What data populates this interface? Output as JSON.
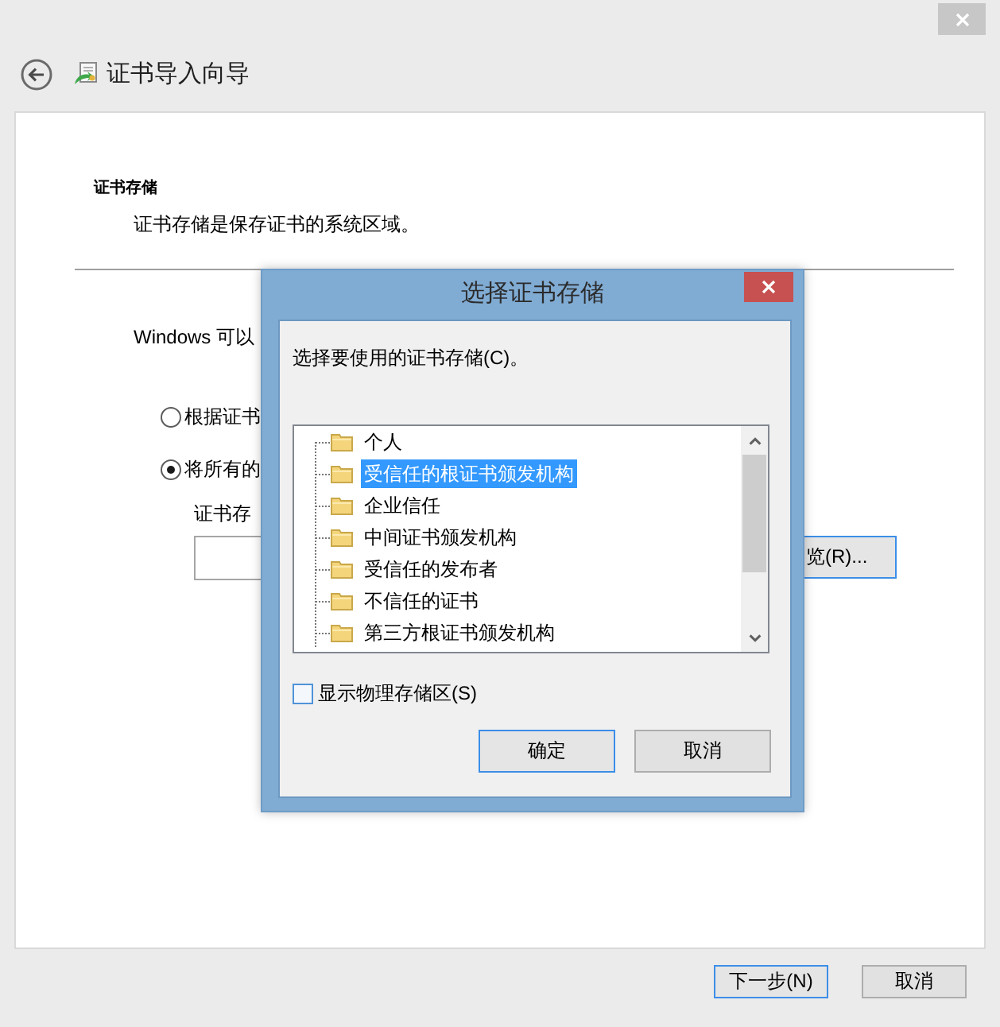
{
  "window": {
    "title": "证书导入向导"
  },
  "section": {
    "heading": "证书存储",
    "description": "证书存储是保存证书的系统区域。"
  },
  "intro": "Windows 可以",
  "options": [
    {
      "label": "根据证书",
      "selected": false
    },
    {
      "label": "将所有的",
      "selected": true
    }
  ],
  "store_field": {
    "label": "证书存"
  },
  "browse_button": {
    "label": "览(R)...",
    "focused": true
  },
  "dialog": {
    "title": "选择证书存储",
    "prompt": "选择要使用的证书存储(C)。",
    "stores": [
      {
        "name": "个人",
        "selected": false
      },
      {
        "name": "受信任的根证书颁发机构",
        "selected": true
      },
      {
        "name": "企业信任",
        "selected": false
      },
      {
        "name": "中间证书颁发机构",
        "selected": false
      },
      {
        "name": "受信任的发布者",
        "selected": false
      },
      {
        "name": "不信任的证书",
        "selected": false
      },
      {
        "name": "第三方根证书颁发机构",
        "selected": false
      }
    ],
    "show_physical": {
      "label": "显示物理存储区(S)",
      "checked": false
    },
    "buttons": [
      {
        "label": "确定",
        "focused": true
      },
      {
        "label": "取消",
        "focused": false
      }
    ]
  },
  "footer_buttons": [
    {
      "label": "下一步(N)",
      "focused": true
    },
    {
      "label": "取消",
      "focused": false
    }
  ]
}
